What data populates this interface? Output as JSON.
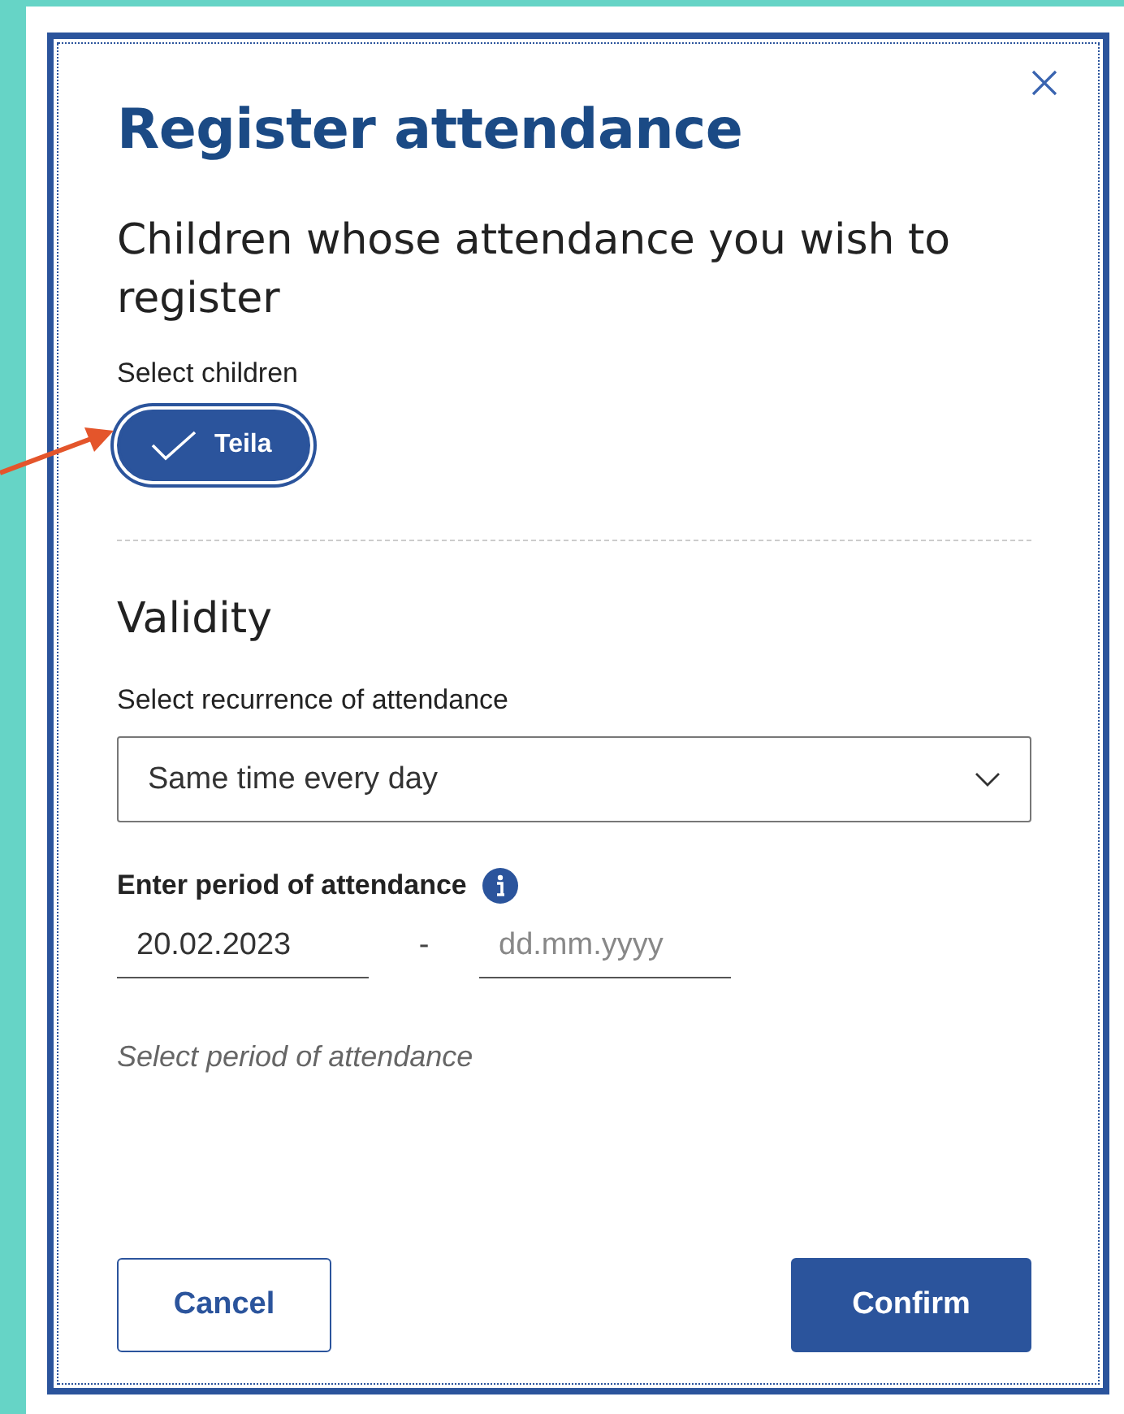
{
  "dialog": {
    "title": "Register attendance",
    "children_section": {
      "heading": "Children whose attendance you wish to register",
      "label": "Select children",
      "chips": [
        {
          "label": "Teila",
          "selected": true
        }
      ]
    },
    "validity_section": {
      "heading": "Validity",
      "recurrence": {
        "label": "Select recurrence of attendance",
        "value": "Same time every day"
      },
      "period": {
        "label": "Enter period of attendance",
        "start": {
          "value": "20.02.2023"
        },
        "separator": "-",
        "end": {
          "placeholder": "dd.mm.yyyy"
        },
        "hint": "Select period of attendance"
      }
    },
    "buttons": [
      {
        "label": "Cancel",
        "kind": "secondary"
      },
      {
        "label": "Confirm",
        "kind": "primary"
      }
    ]
  },
  "annotation": {
    "kind": "arrow"
  }
}
